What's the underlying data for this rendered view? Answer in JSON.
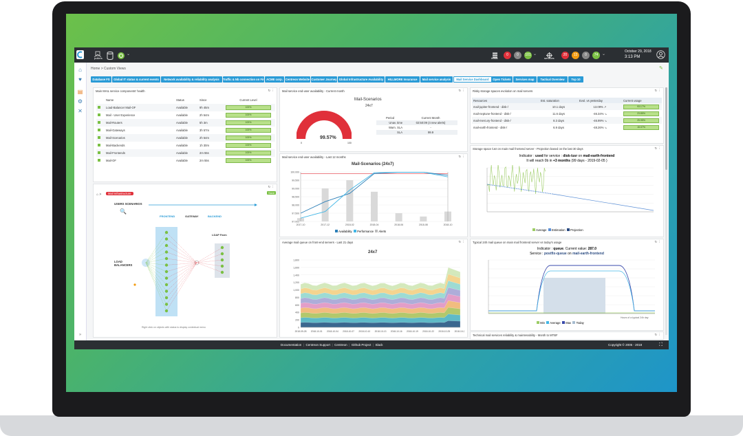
{
  "topbar": {
    "pollers_label": "pollers",
    "hosts_label": "hosts",
    "services_label": "services",
    "host_counts": [
      "0",
      "0",
      "101"
    ],
    "service_counts": [
      "20",
      "13",
      "0",
      "74"
    ],
    "date": "October 29, 2018",
    "time": "3:13 PM"
  },
  "breadcrumb": "Home > Custom Views",
  "tabs": [
    {
      "label": "Database FS",
      "active": false
    },
    {
      "label": "Global IT status & current events",
      "active": false
    },
    {
      "label": "Network availability & reliability analysis",
      "active": false
    },
    {
      "label": "Traffic & Nb connection on Firewall",
      "active": false
    },
    {
      "label": "ACME corp.",
      "active": false
    },
    {
      "label": "Centreon Website",
      "active": false
    },
    {
      "label": "Customer Journey",
      "active": false
    },
    {
      "label": "Global Infrastructure Availability",
      "active": false
    },
    {
      "label": "HILLMORE Insurance",
      "active": false
    },
    {
      "label": "Mail service analysis",
      "active": false
    },
    {
      "label": "Mail Service Dashboard",
      "active": true
    },
    {
      "label": "Open Tickets",
      "active": false
    },
    {
      "label": "Services map",
      "active": false
    },
    {
      "label": "Tactical Overview",
      "active": false
    },
    {
      "label": "Top 10",
      "active": false
    }
  ],
  "health_widget": {
    "title": "Main MAIL service components' health",
    "columns": [
      "Name",
      "Status",
      "Since",
      "Current Level"
    ],
    "rows": [
      {
        "name": "Load-Balancer Mail-OF",
        "status": "Available",
        "since": "9h 45m",
        "level": "100%"
      },
      {
        "name": "Mail - User Experience",
        "status": "Available",
        "since": "2h 54m",
        "level": "100%"
      },
      {
        "name": "Mail-Routers",
        "status": "Available",
        "since": "5h 3m",
        "level": "100%"
      },
      {
        "name": "Mail-Gateways",
        "status": "Available",
        "since": "3h 57m",
        "level": "100%"
      },
      {
        "name": "Mail-Scenarios",
        "status": "Available",
        "since": "2h 54m",
        "level": "100%"
      },
      {
        "name": "Mail-Backends",
        "status": "Available",
        "since": "1h 30m",
        "level": "100%"
      },
      {
        "name": "Mail-Frontends",
        "status": "Available",
        "since": "2m 55s",
        "level": "100%"
      },
      {
        "name": "Mail-OF",
        "status": "Available",
        "since": "2m 55s",
        "level": "100%"
      }
    ]
  },
  "avail_month_widget": {
    "title": "Mail service end-user availability - Current month",
    "chart_title": "Mail-Scenarios",
    "chart_subtitle": "24x7",
    "gauge_value": "99.57%",
    "gauge_min": "0",
    "gauge_max": "100",
    "table_head": [
      "Period",
      "Current Month"
    ],
    "table_rows": [
      {
        "k": "Unav. time",
        "v": "02:50:09 (4 new alerts)"
      },
      {
        "k": "Warn. SLA",
        "v": "-"
      },
      {
        "k": "SLA",
        "v": "99.9"
      }
    ]
  },
  "storage_widget": {
    "title": "Risky storage spaces evolution on mail servers",
    "columns": [
      "Resources",
      "Est. saturation",
      "Evol. vs yesterday",
      "Current usage"
    ],
    "rows": [
      {
        "name": "mail-jupiter-frontend - disk-/",
        "sat": "10.1 days",
        "evol": "13.09%",
        "usage": "93.17%"
      },
      {
        "name": "mail-neptune-frontend - disk-/",
        "sat": "11.6 days",
        "evol": "-46.34%",
        "usage": "23.85%"
      },
      {
        "name": "mail-mercury-frontend - disk-/",
        "sat": "8.3 days",
        "evol": "-46.99%",
        "usage": "25.95%"
      },
      {
        "name": "mail-earth-frontend - disk-/",
        "sat": "6.9 days",
        "evol": "-48.26%",
        "usage": "15.07%"
      }
    ]
  },
  "avail_12m_widget": {
    "title": "Mail service end-user availability - Last 12 months",
    "chart_title": "Mail-Scenarios (24x7)",
    "legend": [
      "Availability",
      "Performance",
      "Alerts"
    ]
  },
  "storage_projection_widget": {
    "title": "Storage space /usr on main mail frontend server - Projection based on the last 30 days",
    "line1_a": "Indicator : ",
    "line1_b": "used",
    "line1_c": " for service : ",
    "line1_d": "disk-/usr",
    "line1_e": " on ",
    "line1_f": "mail-earth-frontend",
    "line2_a": "It will reach 0b in ",
    "line2_b": "+3 months",
    "line2_c": " (99 days - 2019-02-05 )",
    "legend": [
      "Average",
      "Estimation",
      "Projection"
    ]
  },
  "map_widget": {
    "badge": "Mail Infrastructure",
    "save": "Save",
    "users": "USERS SCENARIOS",
    "frontend": "FRONTEND",
    "gateway": "GATEWAY",
    "backend": "BACKEND",
    "ldap": "LDAP Farm",
    "lb": "LOAD BALANCERS",
    "hint": "Right click on objects with status to display contextual menu"
  },
  "queue_widget": {
    "title": "Average mail queue on front-end servers - Last 21 days",
    "chart_title": "24x7"
  },
  "typical_widget": {
    "title": "Typical 24h mail queue on main mail frontend server vs today's usage",
    "line1_a": "Indicator : ",
    "line1_b": "queue",
    "line1_c": ". Current value: ",
    "line1_d": "287.0",
    "line2_a": "Service : ",
    "line2_b": "postfix-queue",
    "line2_c": " on ",
    "line2_d": "mail-earth-frontend",
    "xlabel": "Hours of a typical 24h day",
    "legend": [
      "Min",
      "Average",
      "Max",
      "Today"
    ]
  },
  "bottom_widget": {
    "title": "Technical mail services reliability & maintenability - Month to MTBF"
  },
  "footer": {
    "links": [
      "Documentation",
      "Centreon Support",
      "Centreon",
      "Github Project",
      "Slack"
    ],
    "copyright": "Copyright © 2005 - 2018"
  },
  "chart_data": [
    {
      "type": "line",
      "title": "Mail-Scenarios (24x7)",
      "categories": [
        "2017-10",
        "2017-12",
        "2018-02",
        "2018-04",
        "2018-06",
        "2018-08",
        "2018-10"
      ],
      "series": [
        {
          "name": "Availability",
          "values": [
            97.5,
            98.2,
            98.7,
            99.9,
            99.98,
            99.98,
            99.8
          ]
        },
        {
          "name": "Performance",
          "values": [
            97.2,
            97.6,
            98.9,
            99.95,
            99.98,
            99.98,
            99.7
          ]
        },
        {
          "name": "Alerts",
          "values": [
            2,
            20,
            25,
            18,
            5,
            3,
            6
          ]
        }
      ],
      "ylim": [
        97,
        100
      ]
    },
    {
      "type": "area",
      "title": "24x7",
      "categories": [
        "2018-09-28",
        "2018-10-01",
        "2018-10-04",
        "2018-10-07",
        "2018-10-10",
        "2018-10-13",
        "2018-10-16",
        "2018-10-19",
        "2018-10-22",
        "2018-10-25",
        "2018-10-28"
      ],
      "ylim": [
        0,
        1800
      ],
      "ytick_labels": [
        "0",
        "200",
        "400",
        "600",
        "800",
        "1,000",
        "1,200",
        "1,400",
        "1,600",
        "1,800"
      ]
    },
    {
      "type": "line",
      "title": "Typical 24h mail queue",
      "series": [
        {
          "name": "Min",
          "values": [
            0,
            0,
            0,
            0
          ]
        },
        {
          "name": "Average",
          "values": [
            20,
            120,
            120,
            20
          ]
        },
        {
          "name": "Max",
          "values": [
            40,
            150,
            150,
            40
          ]
        },
        {
          "name": "Today",
          "values": [
            0,
            90,
            90,
            0
          ]
        }
      ]
    }
  ]
}
